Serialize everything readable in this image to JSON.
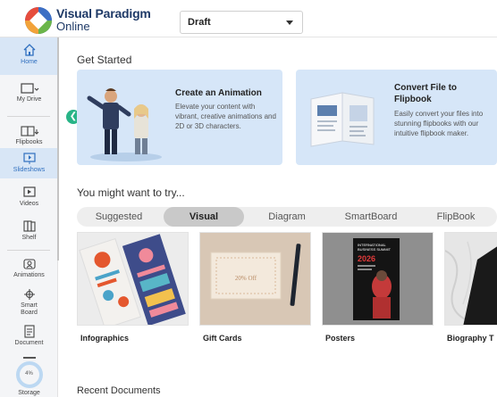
{
  "header": {
    "brand_line1": "Visual Paradigm",
    "brand_line2": "Online",
    "dropdown_value": "Draft"
  },
  "sidebar": {
    "items": [
      {
        "label": "Home",
        "icon": "home-icon"
      },
      {
        "label": "My Drive",
        "icon": "drive-icon"
      },
      {
        "label": "Flipbooks",
        "icon": "flipbook-icon"
      },
      {
        "label": "Slideshows",
        "icon": "slideshow-icon"
      },
      {
        "label": "Videos",
        "icon": "video-icon"
      },
      {
        "label": "Shelf",
        "icon": "shelf-icon"
      },
      {
        "label": "Animations",
        "icon": "animation-icon"
      },
      {
        "label": "Smart Board",
        "icon": "smartboard-icon"
      },
      {
        "label": "Document",
        "icon": "document-icon"
      }
    ],
    "storage": {
      "percent": "4%",
      "label": "Storage"
    }
  },
  "main": {
    "get_started_title": "Get Started",
    "cards": [
      {
        "title": "Create an Animation",
        "desc": "Elevate your content with vibrant, creative animations and 2D or 3D characters."
      },
      {
        "title": "Convert File to Flipbook",
        "desc": "Easily convert your files into stunning flipbooks with our intuitive flipbook maker."
      }
    ],
    "try_title": "You might want to try...",
    "tabs": [
      "Suggested",
      "Visual",
      "Diagram",
      "SmartBoard",
      "FlipBook"
    ],
    "active_tab": "Visual",
    "tiles": [
      "Infographics",
      "Gift Cards",
      "Posters",
      "Biography T"
    ],
    "poster_text": {
      "line1": "INTERNATIONAL",
      "line2": "BUSINESS SUMMIT",
      "year": "2026"
    },
    "giftcard_text": "20% Off",
    "recent_title": "Recent Documents"
  },
  "colors": {
    "accent": "#2f6fbf",
    "card_bg": "#d6e6f8",
    "collapse": "#28b487"
  }
}
